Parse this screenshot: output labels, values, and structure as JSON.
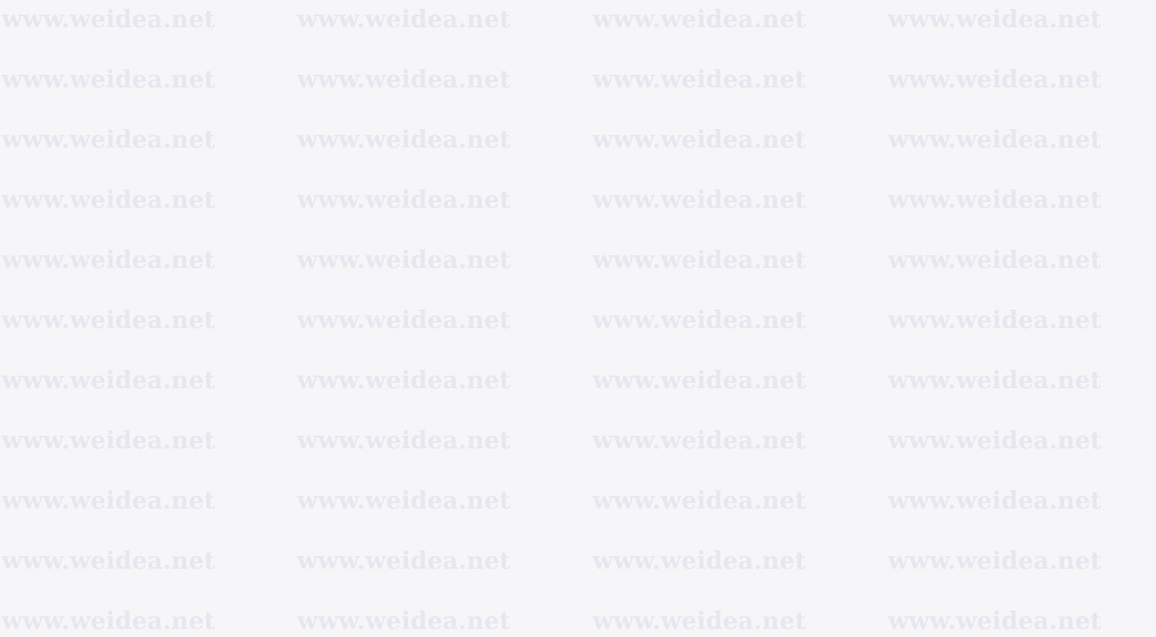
{
  "page": {
    "background_color": "#f6f6f8",
    "watermark_color": "#e7e7f0"
  },
  "watermark": {
    "text": "www.weidea.net",
    "rows": 11,
    "columns": 4
  }
}
